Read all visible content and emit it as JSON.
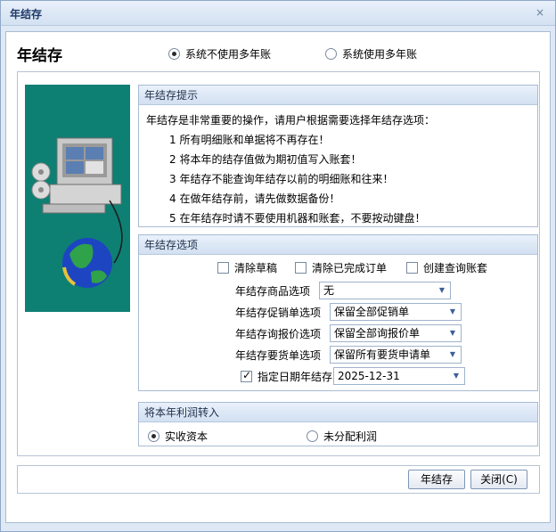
{
  "window": {
    "title": "年结存",
    "close_glyph": "×"
  },
  "header": {
    "title": "年结存",
    "radio_options": [
      {
        "label": "系统不使用多年账",
        "selected": true
      },
      {
        "label": "系统使用多年账",
        "selected": false
      }
    ]
  },
  "tips": {
    "title": "年结存提示",
    "intro": "年结存是非常重要的操作，请用户根据需要选择年结存选项：",
    "items": [
      "1 所有明细账和单据将不再存在！",
      "2 将本年的结存值做为期初值写入账套！",
      "3 年结存不能查询年结存以前的明细账和往来！",
      "4 在做年结存前，请先做数据备份！",
      "5 在年结存时请不要使用机器和账套，不要按动键盘！"
    ]
  },
  "options": {
    "title": "年结存选项",
    "checkboxes": [
      {
        "label": "清除草稿",
        "checked": false
      },
      {
        "label": "清除已完成订单",
        "checked": false
      },
      {
        "label": "创建查询账套",
        "checked": false
      }
    ],
    "fields": [
      {
        "label": "年结存商品选项",
        "value": "无"
      },
      {
        "label": "年结存促销单选项",
        "value": "保留全部促销单"
      },
      {
        "label": "年结存询报价选项",
        "value": "保留全部询报价单"
      },
      {
        "label": "年结存要货单选项",
        "value": "保留所有要货申请单"
      }
    ],
    "date_option": {
      "label": "指定日期年结存",
      "checked": true,
      "value": "2025-12-31"
    }
  },
  "profit": {
    "title": "将本年利润转入",
    "radio_options": [
      {
        "label": "实收资本",
        "selected": true
      },
      {
        "label": "未分配利润",
        "selected": false
      }
    ]
  },
  "buttons": {
    "confirm": "年结存",
    "close": "关闭(C)"
  },
  "icons": {
    "dropdown_arrow": "▼"
  },
  "colors": {
    "sidebar_bg": "#0e7f73",
    "title_text": "#1f3a6a"
  }
}
